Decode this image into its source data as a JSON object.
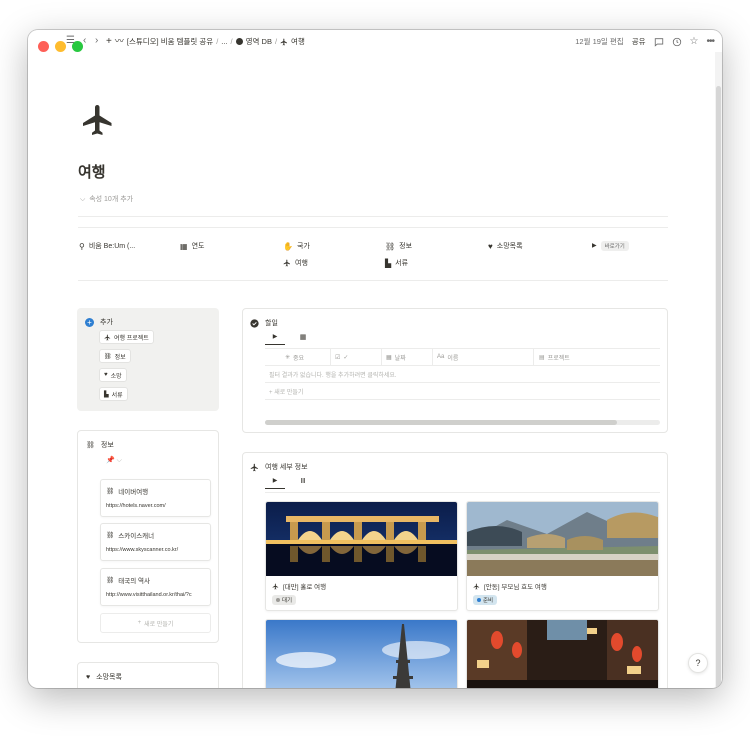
{
  "titlebar": {
    "breadcrumb_1": "[스튜디오] 비움 템플릿 공유",
    "breadcrumb_ellipsis": "...",
    "breadcrumb_2": "영역 DB",
    "breadcrumb_3": "여행",
    "edited": "12월 19일 편집",
    "share": "공유"
  },
  "page": {
    "title": "여행",
    "props_toggle": "속성 10개 추가"
  },
  "links": {
    "item_1": "비움 Be:Um (...",
    "item_2": "연도",
    "item_3": "국가",
    "item_4": "정보",
    "item_5": "소망목록",
    "item_6": "바로가기",
    "item_7": "여행",
    "item_8": "서류"
  },
  "add_card": {
    "title": "추가",
    "btn_1": "여행 프로젝트",
    "btn_2": "정보",
    "btn_3": "소망",
    "btn_4": "서류"
  },
  "info_card": {
    "title": "정보",
    "items": [
      {
        "title": "네이버여행",
        "url": "https://hotels.naver.com/"
      },
      {
        "title": "스카이스캐너",
        "url": "https://www.skyscanner.co.kr/"
      },
      {
        "title": "태국의 역사",
        "url": "http://www.visitthailand.or.kr/thai/?c"
      }
    ],
    "new_label": "새로 만들기"
  },
  "wish_card": {
    "title": "소망목록"
  },
  "todo": {
    "title": "할일",
    "col_1": "중요",
    "col_2": "✓",
    "col_3": "날짜",
    "col_4": "이름",
    "col_5": "프로젝트",
    "empty": "필터 결과가 없습니다. 행을 추가하려면 클릭하세요.",
    "new_row": "새로 만들기",
    "scroll_fraction": 0.89
  },
  "trip": {
    "title": "여행 세부 정보",
    "cards": [
      {
        "title": "[대만] 홀로 여행",
        "tag": "대기",
        "tag_bg": "#e9e9e7",
        "tag_dot": "#9b9a97"
      },
      {
        "title": "[안동] 부모님 효도 여행",
        "tag": "준비",
        "tag_bg": "#d3e5ef",
        "tag_dot": "#2f7fd1"
      },
      {
        "title": "",
        "tag": ""
      },
      {
        "title": "",
        "tag": ""
      }
    ]
  },
  "help": {
    "label": "?"
  },
  "colors": {
    "accent_blue": "#2f7fd1",
    "text": "#37352f",
    "muted": "#9b9a97"
  }
}
